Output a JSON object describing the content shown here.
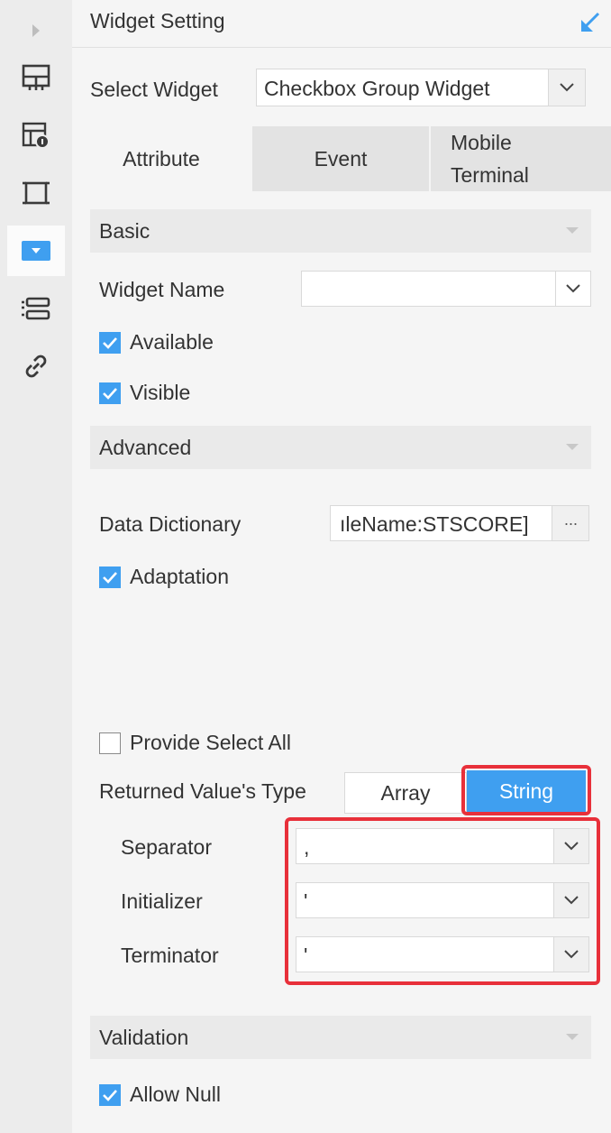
{
  "panel": {
    "title": "Widget Setting"
  },
  "select_widget": {
    "label": "Select Widget",
    "value": "Checkbox Group Widget"
  },
  "tabs": [
    {
      "label": "Attribute",
      "active": true
    },
    {
      "label": "Event",
      "active": false
    },
    {
      "label": "Mobile Terminal",
      "active": false
    }
  ],
  "basic": {
    "title": "Basic",
    "widget_name_label": "Widget Name",
    "widget_name_value": "",
    "available_label": "Available",
    "available_checked": true,
    "visible_label": "Visible",
    "visible_checked": true
  },
  "advanced": {
    "title": "Advanced",
    "data_dictionary_label": "Data Dictionary",
    "data_dictionary_value": "ıleName:STSCORE]",
    "ellipsis": "···",
    "adaptation_label": "Adaptation",
    "adaptation_checked": true,
    "select_all_label": "Provide Select All",
    "select_all_checked": false,
    "returned_type_label": "Returned Value's Type",
    "type_options": [
      "Array",
      "String"
    ],
    "type_selected": "String",
    "separator_label": "Separator",
    "separator_value": ",",
    "initializer_label": "Initializer",
    "initializer_value": "'",
    "terminator_label": "Terminator",
    "terminator_value": "'"
  },
  "validation": {
    "title": "Validation",
    "allow_null_label": "Allow Null",
    "allow_null_checked": true
  },
  "colors": {
    "accent": "#3f9ff0",
    "highlight": "#e8303a",
    "rail": "#ececec"
  },
  "icons": [
    "expand-arrow-icon",
    "layout-grid-icon",
    "table-info-icon",
    "frame-icon",
    "dropdown-widget-icon",
    "form-layout-icon",
    "link-icon",
    "collapse-arrow-icon"
  ]
}
